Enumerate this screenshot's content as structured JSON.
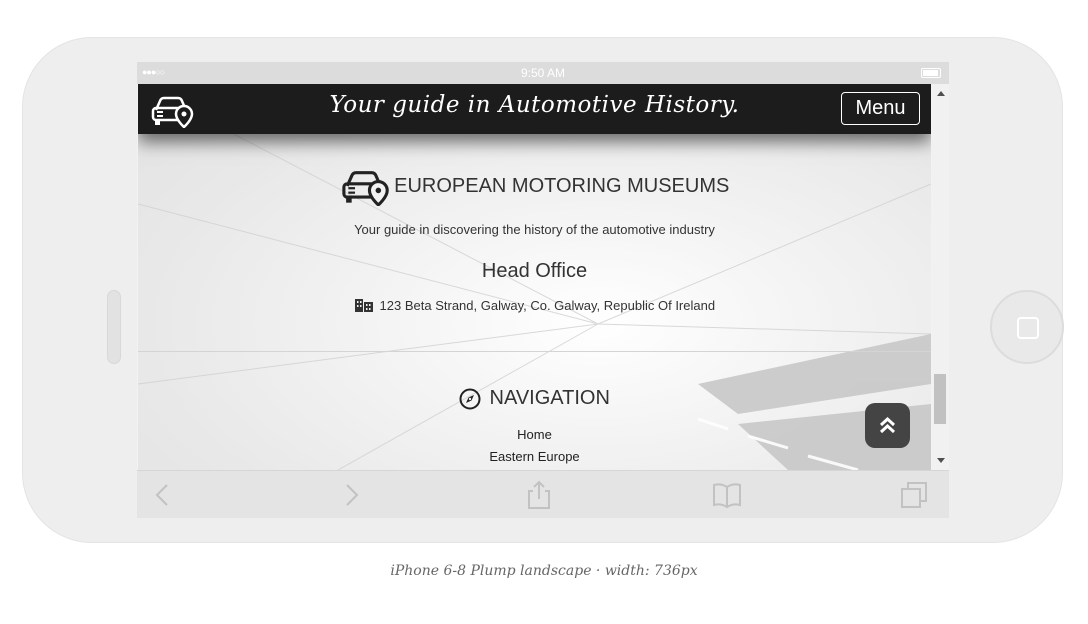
{
  "device": {
    "status_time": "9:50 AM",
    "caption": "iPhone 6-8 Plump landscape · width: 736px"
  },
  "navbar": {
    "tagline": "Your guide in Automotive History.",
    "menu_label": "Menu",
    "brand_icon": "car-location-icon"
  },
  "museum": {
    "title": "EUROPEAN MOTORING MUSEUMS",
    "subtitle": "Your guide in discovering the history of the automotive industry",
    "icon": "car-location-icon"
  },
  "office": {
    "title": "Head Office",
    "address": "123 Beta Strand, Galway, Co. Galway, Republic Of Ireland",
    "icon": "building-icon"
  },
  "navigation": {
    "title": "NAVIGATION",
    "icon": "compass-icon",
    "links": [
      "Home",
      "Eastern Europe"
    ]
  },
  "toolbar": {
    "icons": [
      "back-arrow-icon",
      "forward-arrow-icon",
      "share-icon",
      "bookmarks-icon",
      "tabs-icon"
    ]
  },
  "colors": {
    "navbar_bg": "#1c1c1c",
    "back_to_top_bg": "#444444",
    "text": "#333333"
  }
}
